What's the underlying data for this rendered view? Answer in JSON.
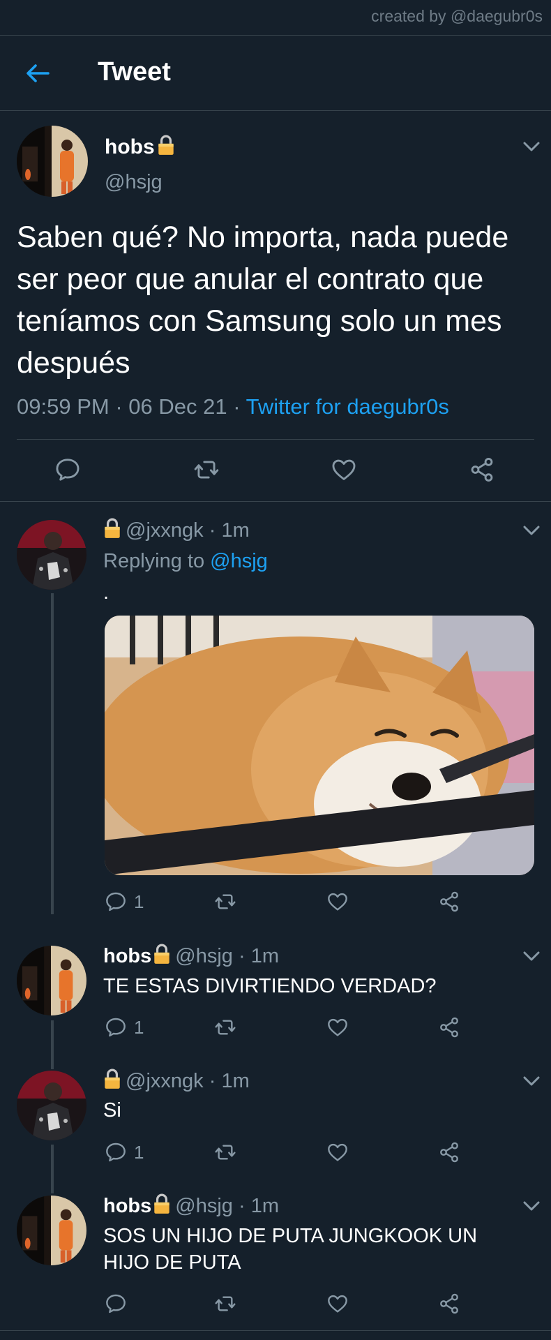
{
  "credit": "created by @daegubr0s",
  "header": {
    "title": "Tweet"
  },
  "main_tweet": {
    "name": "hobs",
    "handle": "@hsjg",
    "text": "Saben qué? No importa, nada puede ser peor que anular el contrato que teníamos con Samsung solo un mes después",
    "time": "09:59 PM",
    "sep1": "·",
    "date": "06 Dec 21",
    "sep2": "·",
    "source": "Twitter for daegubr0s"
  },
  "replies": [
    {
      "handle": "@jxxngk",
      "sep": "·",
      "time": "1m",
      "replying_prefix": "Replying to",
      "replying_to": "@hsjg",
      "text": ".",
      "reply_count": "1"
    },
    {
      "name": "hobs",
      "handle": "@hsjg",
      "sep": "·",
      "time": "1m",
      "text": "TE ESTAS DIVIRTIENDO VERDAD?",
      "reply_count": "1"
    },
    {
      "handle": "@jxxngk",
      "sep": "·",
      "time": "1m",
      "text": "Si",
      "reply_count": "1"
    },
    {
      "name": "hobs",
      "handle": "@hsjg",
      "sep": "·",
      "time": "1m",
      "text": "SOS UN HIJO DE PUTA JUNGKOOK UN HIJO DE PUTA"
    }
  ],
  "icons": {
    "back": "arrow-left-icon",
    "lock": "lock-icon",
    "chevron": "chevron-down-icon",
    "reply": "reply-icon",
    "retweet": "retweet-icon",
    "like": "heart-icon",
    "share": "share-icon"
  },
  "colors": {
    "background": "#15202b",
    "accent": "#1da1f2",
    "muted": "#8899a6",
    "divider": "#38444d",
    "lock": "#f5b53f"
  }
}
